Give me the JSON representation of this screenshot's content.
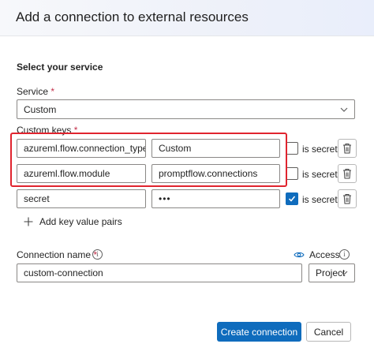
{
  "dialog": {
    "title": "Add a connection to external resources"
  },
  "service_section": {
    "title": "Select your service",
    "service_label": "Service",
    "service_required_mark": "*",
    "service_value": "Custom"
  },
  "custom_keys": {
    "label": "Custom keys",
    "required_mark": "*",
    "secret_label": "is secret",
    "rows": [
      {
        "key": "azureml.flow.connection_type",
        "value": "Custom",
        "is_secret": false
      },
      {
        "key": "azureml.flow.module",
        "value": "promptflow.connections",
        "is_secret": false
      },
      {
        "key": "secret",
        "value": "•••",
        "is_secret": true
      }
    ],
    "add_label": "Add key value pairs"
  },
  "connection": {
    "name_label": "Connection name",
    "name_required_mark": "*",
    "name_value": "custom-connection",
    "access_label": "Access",
    "access_value": "Project"
  },
  "footer": {
    "create_label": "Create connection",
    "cancel_label": "Cancel"
  },
  "colors": {
    "primary": "#0f6cbd",
    "highlight": "#e0242e",
    "required": "#c4314b"
  }
}
